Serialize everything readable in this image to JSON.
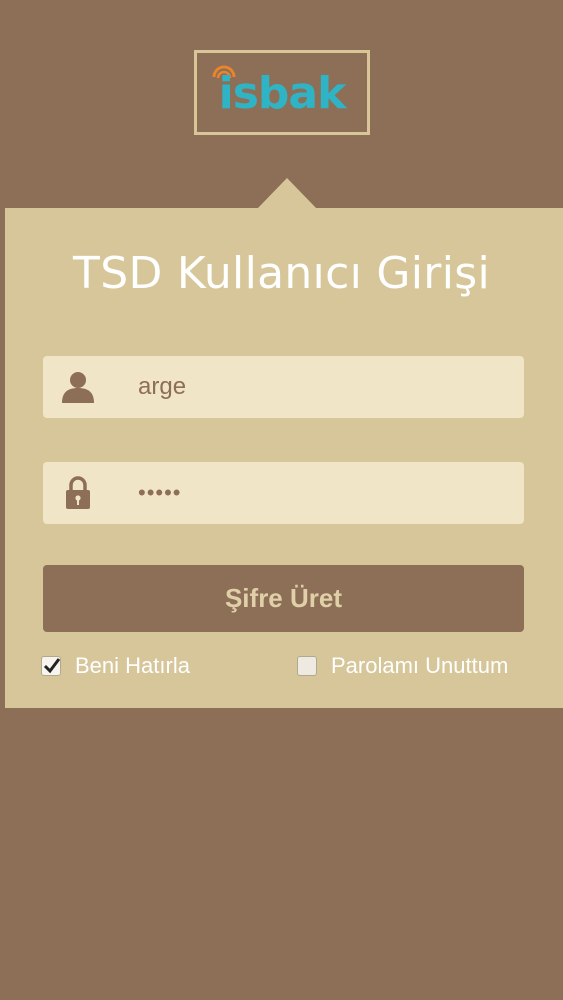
{
  "logo": {
    "text": "isbak"
  },
  "login": {
    "title": "TSD Kullanıcı Girişi",
    "username": {
      "value": "arge"
    },
    "password": {
      "value": "•••••"
    },
    "submit_label": "Şifre Üret",
    "remember": {
      "label": "Beni Hatırla",
      "checked": true
    },
    "forgot": {
      "label": "Parolamı Unuttum",
      "checked": false
    }
  },
  "icons": {
    "username": "user-icon",
    "password": "lock-icon",
    "remember": "checkmark-icon"
  },
  "colors": {
    "background": "#8d6e56",
    "card": "#d6c699",
    "field": "#f1e5c7",
    "accent": "#2fb4c6",
    "button_text": "#e0d0a8"
  }
}
